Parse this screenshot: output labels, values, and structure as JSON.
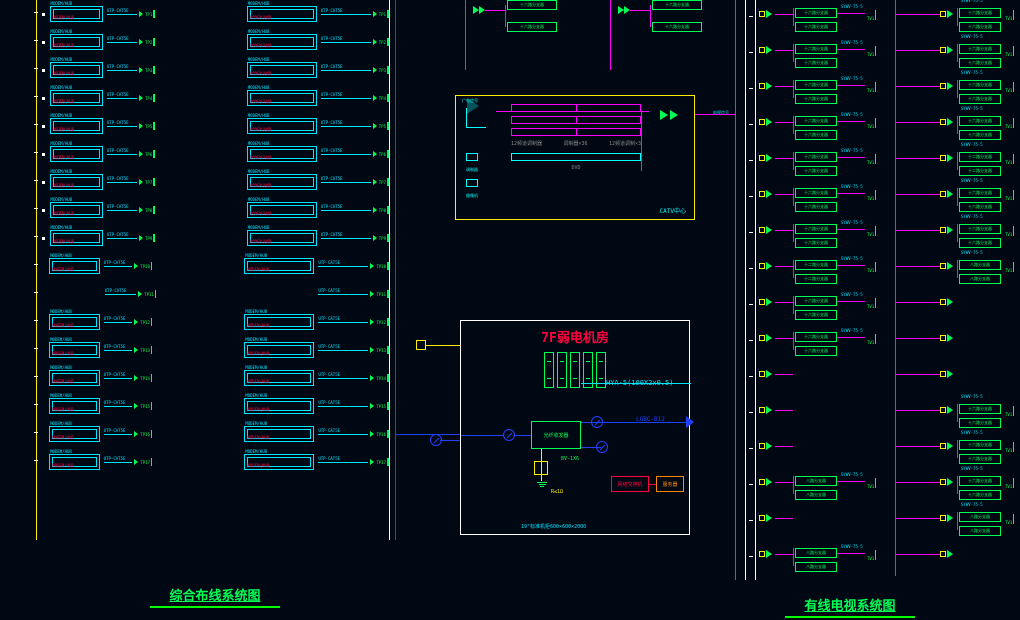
{
  "titles": {
    "left": "综合布线系统图",
    "right": "有线电视系统图"
  },
  "room": {
    "title": "7F弱电机房",
    "hya": "HYA-5(100X2x0.5)",
    "lgbc": "LGBC-B12",
    "opt": "光纤收发器",
    "bv": "BV-1X6",
    "gnd": "R≤1Ω",
    "switch": "网络交换机",
    "server": "服务器",
    "rack_spec": "19\"标准机柜600×600×2000"
  },
  "catv": {
    "title": "CATV中心",
    "ant_label": "广电信号",
    "row1": "12频道调制器",
    "row1b": "调制器×36",
    "row2": "12频道调制×3",
    "dvd": "DVD",
    "bottom_dev": [
      "调制器",
      "摄像机"
    ],
    "out": "电视信号"
  },
  "left_rows": [
    {
      "mod": "MODEM/HUB",
      "cab": "UTP-CAT5E",
      "dst": "TP1",
      "pair": true,
      "icon": "hub"
    },
    {
      "mod": "MODEM/HUB",
      "cab": "UTP-CAT5E",
      "dst": "TP2",
      "pair": true,
      "icon": "hub"
    },
    {
      "mod": "MODEM/HUB",
      "cab": "UTP-CAT5E",
      "dst": "TP3",
      "pair": true,
      "icon": "hub"
    },
    {
      "mod": "MODEM/HUB",
      "cab": "UTP-CAT5E",
      "dst": "TP4",
      "pair": true,
      "icon": "hub"
    },
    {
      "mod": "MODEM/HUB",
      "cab": "UTP-CAT5E",
      "dst": "TP5",
      "pair": true,
      "icon": "hub"
    },
    {
      "mod": "MODEM/HUB",
      "cab": "UTP-CAT5E",
      "dst": "TP6",
      "pair": true,
      "icon": "hub"
    },
    {
      "mod": "MODEM/HUB",
      "cab": "UTP-CAT5E",
      "dst": "TP7",
      "pair": true,
      "icon": "hub"
    },
    {
      "mod": "MODEM/HUB",
      "cab": "UTP-CAT5E",
      "dst": "TP8",
      "pair": true,
      "icon": "hub"
    },
    {
      "mod": "MODEM/HUB",
      "cab": "UTP-CAT5E",
      "dst": "TP9",
      "pair": true,
      "icon": "hub"
    },
    {
      "mod": "MODEM/HUB",
      "cab": "UTP-CAT5E",
      "dst": "TP10",
      "pair": true,
      "icon": ""
    },
    {
      "mod": "",
      "cab": "UTP-CAT5E",
      "dst": "TP11",
      "pair": true,
      "icon": ""
    },
    {
      "mod": "MODEM/HUB",
      "cab": "UTP-CAT5E",
      "dst": "TP12",
      "pair": true,
      "icon": ""
    },
    {
      "mod": "MODEM/HUB",
      "cab": "UTP-CAT5E",
      "dst": "TP13",
      "pair": true,
      "icon": ""
    },
    {
      "mod": "MODEM/HUB",
      "cab": "UTP-CAT5E",
      "dst": "TP14",
      "pair": true,
      "icon": ""
    },
    {
      "mod": "MODEM/HUB",
      "cab": "UTP-CAT5E",
      "dst": "TP15",
      "pair": true,
      "icon": ""
    },
    {
      "mod": "MODEM/HUB",
      "cab": "UTP-CAT5E",
      "dst": "TP16",
      "pair": true,
      "icon": ""
    },
    {
      "mod": "MODEM/HUB",
      "cab": "UTP-CAT5E",
      "dst": "TP17",
      "pair": true,
      "icon": ""
    }
  ],
  "tv_rows": [
    {
      "a": "十六路分支器",
      "b": "十六路分支器"
    },
    {
      "a": "十六路分支器",
      "b": "十六路分支器"
    },
    {
      "a": "十六路分支器",
      "b": "十六路分支器"
    },
    {
      "a": "十六路分支器",
      "b": "十六路分支器"
    },
    {
      "a": "十六路分支器",
      "b": "十二路分支器"
    },
    {
      "a": "十六路分支器",
      "b": "十六路分支器"
    },
    {
      "a": "十六路分支器",
      "b": "十六路分支器"
    },
    {
      "a": "十二路分支器",
      "b": "八路分支器"
    },
    {
      "a": "十六路分支器",
      "b": ""
    },
    {
      "a": "十六路分支器",
      "b": ""
    },
    {
      "a": "",
      "b": ""
    },
    {
      "a": "",
      "b": "十六路分支器"
    },
    {
      "a": "",
      "b": "十六路分支器"
    },
    {
      "a": "八路分支器",
      "b": "十六路分支器"
    },
    {
      "a": "",
      "b": "八路分支器"
    },
    {
      "a": "八路分支器",
      "b": ""
    }
  ],
  "tv_cable": "SYWV-75-5",
  "tv_port": "TV1",
  "top_split": {
    "boxes": [
      "十六路分支器",
      "十六路分支器",
      "十六路分支器",
      "十六路分支器"
    ]
  }
}
